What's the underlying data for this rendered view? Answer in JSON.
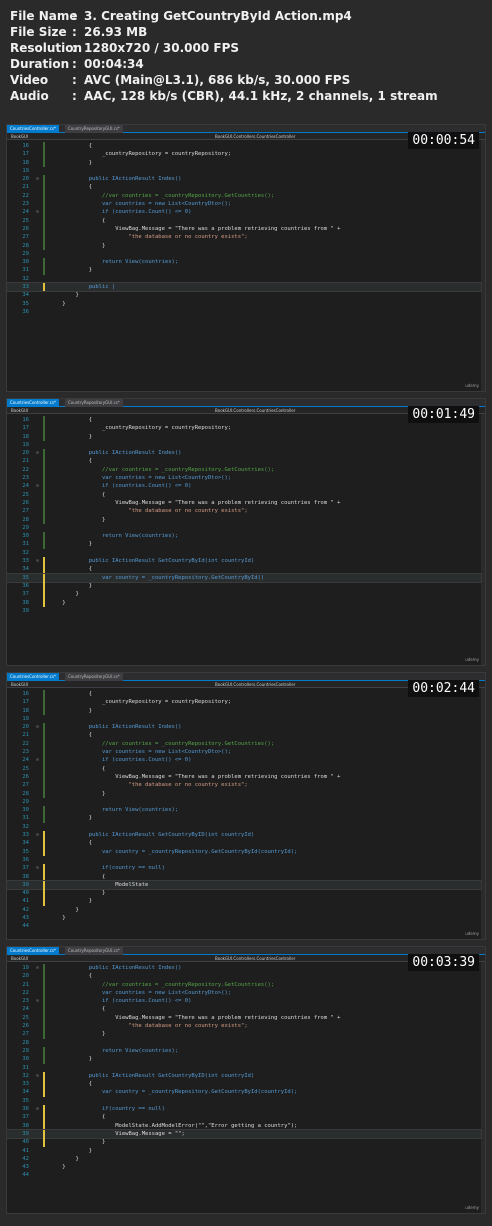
{
  "metadata": [
    {
      "key": "File Name",
      "value": "3. Creating GetCountryById Action.mp4"
    },
    {
      "key": "File Size",
      "value": "26.93 MB"
    },
    {
      "key": "Resolution",
      "value": "1280x720 / 30.000 FPS"
    },
    {
      "key": "Duration",
      "value": "00:04:34"
    },
    {
      "key": "Video",
      "value": "AVC (Main@L3.1), 686 kb/s, 30.000 FPS"
    },
    {
      "key": "Audio",
      "value": "AAC, 128 kb/s (CBR), 44.1 kHz, 2 channels, 1 stream"
    }
  ],
  "colors": {
    "background": "#2a2a2a",
    "editor_bg": "#1e1e1e",
    "keyword": "#569cd6",
    "type": "#4ec9b0",
    "string": "#d69d85",
    "comment": "#57a64a",
    "line_number": "#2b91af",
    "change_yellow": "#e2c33d",
    "change_green": "#57a64a"
  },
  "frames": [
    {
      "timestamp": "00:00:54",
      "tabs": [
        "CountriesController.cs*",
        "CountryRepositoryGUI.cs*"
      ],
      "project": "BookGUI",
      "namespace": "BookGUI.Controllers.CountriesController",
      "watermark": "udemy",
      "lines": [
        {
          "num": "16",
          "text": "            {"
        },
        {
          "num": "17",
          "text": "                _countryRepository = countryRepository;"
        },
        {
          "num": "18",
          "text": "            }"
        },
        {
          "num": "19",
          "text": ""
        },
        {
          "num": "20",
          "text": "            public IActionResult Index()"
        },
        {
          "num": "21",
          "text": "            {"
        },
        {
          "num": "22",
          "text": "                //var countries = _countryRepository.GetCountries();"
        },
        {
          "num": "23",
          "text": "                var countries = new List<CountryDto>();"
        },
        {
          "num": "24",
          "text": "                if (countries.Count() <= 0)"
        },
        {
          "num": "25",
          "text": "                {"
        },
        {
          "num": "26",
          "text": "                    ViewBag.Message = \"There was a problem retrieving countries from \" +"
        },
        {
          "num": "27",
          "text": "                        \"the database or no country exists\";"
        },
        {
          "num": "28",
          "text": "                }"
        },
        {
          "num": "29",
          "text": ""
        },
        {
          "num": "30",
          "text": "                return View(countries);"
        },
        {
          "num": "31",
          "text": "            }"
        },
        {
          "num": "32",
          "text": ""
        },
        {
          "num": "33",
          "text": "            public |"
        },
        {
          "num": "34",
          "text": "        }"
        },
        {
          "num": "35",
          "text": "    }"
        },
        {
          "num": "36",
          "text": ""
        }
      ]
    },
    {
      "timestamp": "00:01:49",
      "tabs": [
        "CountriesController.cs*",
        "CountryRepositoryGUI.cs*"
      ],
      "project": "BookGUI",
      "namespace": "BookGUI.Controllers.CountriesController",
      "watermark": "udemy",
      "lines": [
        {
          "num": "16",
          "text": "            {"
        },
        {
          "num": "17",
          "text": "                _countryRepository = countryRepository;"
        },
        {
          "num": "18",
          "text": "            }"
        },
        {
          "num": "19",
          "text": ""
        },
        {
          "num": "20",
          "text": "            public IActionResult Index()"
        },
        {
          "num": "21",
          "text": "            {"
        },
        {
          "num": "22",
          "text": "                //var countries = _countryRepository.GetCountries();"
        },
        {
          "num": "23",
          "text": "                var countries = new List<CountryDto>();"
        },
        {
          "num": "24",
          "text": "                if (countries.Count() <= 0)"
        },
        {
          "num": "25",
          "text": "                {"
        },
        {
          "num": "26",
          "text": "                    ViewBag.Message = \"There was a problem retrieving countries from \" +"
        },
        {
          "num": "27",
          "text": "                        \"the database or no country exists\";"
        },
        {
          "num": "28",
          "text": "                }"
        },
        {
          "num": "29",
          "text": ""
        },
        {
          "num": "30",
          "text": "                return View(countries);"
        },
        {
          "num": "31",
          "text": "            }"
        },
        {
          "num": "32",
          "text": ""
        },
        {
          "num": "33",
          "text": "            public IActionResult GetCountryById(int countryId)"
        },
        {
          "num": "34",
          "text": "            {"
        },
        {
          "num": "35",
          "text": "                var country = _countryRepository.GetCountryById()"
        },
        {
          "num": "36",
          "text": "            }"
        },
        {
          "num": "37",
          "text": "        }"
        },
        {
          "num": "38",
          "text": "    }"
        },
        {
          "num": "39",
          "text": ""
        }
      ]
    },
    {
      "timestamp": "00:02:44",
      "tabs": [
        "CountriesController.cs*",
        "CountryRepositoryGUI.cs*"
      ],
      "project": "BookGUI",
      "namespace": "BookGUI.Controllers.CountriesController",
      "watermark": "udemy",
      "lines": [
        {
          "num": "16",
          "text": "            {"
        },
        {
          "num": "17",
          "text": "                _countryRepository = countryRepository;"
        },
        {
          "num": "18",
          "text": "            }"
        },
        {
          "num": "19",
          "text": ""
        },
        {
          "num": "20",
          "text": "            public IActionResult Index()"
        },
        {
          "num": "21",
          "text": "            {"
        },
        {
          "num": "22",
          "text": "                //var countries = _countryRepository.GetCountries();"
        },
        {
          "num": "23",
          "text": "                var countries = new List<CountryDto>();"
        },
        {
          "num": "24",
          "text": "                if (countries.Count() <= 0)"
        },
        {
          "num": "25",
          "text": "                {"
        },
        {
          "num": "26",
          "text": "                    ViewBag.Message = \"There was a problem retrieving countries from \" +"
        },
        {
          "num": "27",
          "text": "                        \"the database or no country exists\";"
        },
        {
          "num": "28",
          "text": "                }"
        },
        {
          "num": "29",
          "text": ""
        },
        {
          "num": "30",
          "text": "                return View(countries);"
        },
        {
          "num": "31",
          "text": "            }"
        },
        {
          "num": "32",
          "text": ""
        },
        {
          "num": "33",
          "text": "            public IActionResult GetCountryByID(int countryId)"
        },
        {
          "num": "34",
          "text": "            {"
        },
        {
          "num": "35",
          "text": "                var country = _countryRepository.GetCountryById(countryId);"
        },
        {
          "num": "36",
          "text": ""
        },
        {
          "num": "37",
          "text": "                if(country == null)"
        },
        {
          "num": "38",
          "text": "                {"
        },
        {
          "num": "39",
          "text": "                    ModelState"
        },
        {
          "num": "40",
          "text": "                }"
        },
        {
          "num": "41",
          "text": "            }"
        },
        {
          "num": "42",
          "text": "        }"
        },
        {
          "num": "43",
          "text": "    }"
        },
        {
          "num": "44",
          "text": ""
        }
      ]
    },
    {
      "timestamp": "00:03:39",
      "tabs": [
        "CountriesController.cs*",
        "CountryRepositoryGUI.cs*"
      ],
      "project": "BookGUI",
      "namespace": "BookGUI.Controllers.CountriesController",
      "watermark": "udemy",
      "lines": [
        {
          "num": "19",
          "text": "            public IActionResult Index()"
        },
        {
          "num": "20",
          "text": "            {"
        },
        {
          "num": "21",
          "text": "                //var countries = _countryRepository.GetCountries();"
        },
        {
          "num": "22",
          "text": "                var countries = new List<CountryDto>();"
        },
        {
          "num": "23",
          "text": "                if (countries.Count() <= 0)"
        },
        {
          "num": "24",
          "text": "                {"
        },
        {
          "num": "25",
          "text": "                    ViewBag.Message = \"There was a problem retrieving countries from \" +"
        },
        {
          "num": "26",
          "text": "                        \"the database or no country exists\";"
        },
        {
          "num": "27",
          "text": "                }"
        },
        {
          "num": "28",
          "text": ""
        },
        {
          "num": "29",
          "text": "                return View(countries);"
        },
        {
          "num": "30",
          "text": "            }"
        },
        {
          "num": "31",
          "text": ""
        },
        {
          "num": "32",
          "text": "            public IActionResult GetCountryByID(int countryId)"
        },
        {
          "num": "33",
          "text": "            {"
        },
        {
          "num": "34",
          "text": "                var country = _countryRepository.GetCountryById(countryId);"
        },
        {
          "num": "35",
          "text": ""
        },
        {
          "num": "36",
          "text": "                if(country == null)"
        },
        {
          "num": "37",
          "text": "                {"
        },
        {
          "num": "38",
          "text": "                    ModelState.AddModelError(\"\",\"Error getting a country\");"
        },
        {
          "num": "39",
          "text": "                    ViewBag.Message = \"\";"
        },
        {
          "num": "40",
          "text": "                }"
        },
        {
          "num": "41",
          "text": "            }"
        },
        {
          "num": "42",
          "text": "        }"
        },
        {
          "num": "43",
          "text": "    }"
        },
        {
          "num": "44",
          "text": ""
        }
      ]
    }
  ]
}
